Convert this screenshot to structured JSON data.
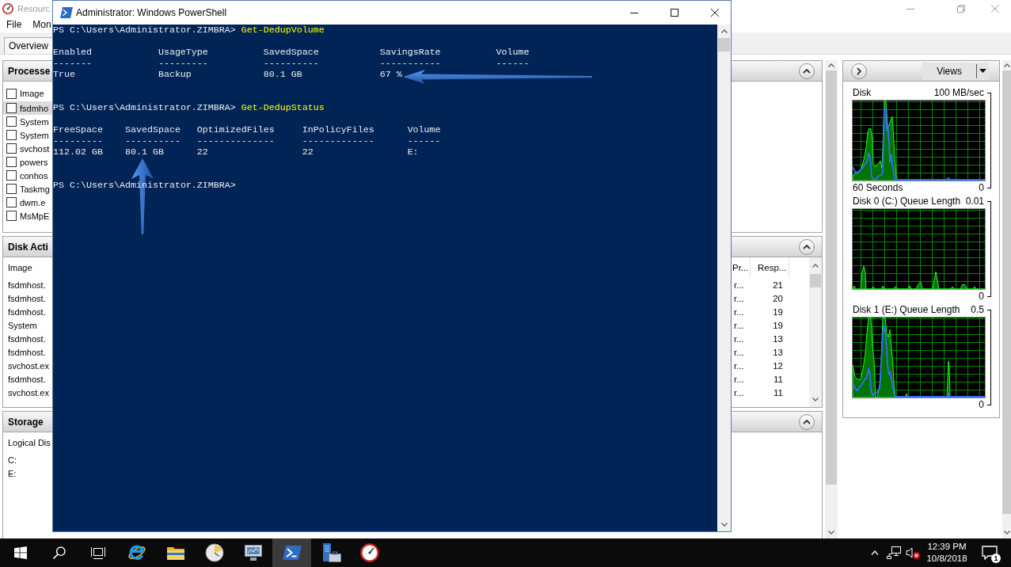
{
  "resource_monitor": {
    "title": "Resourc",
    "menu": [
      "File",
      "Mon"
    ],
    "tabs": [
      {
        "label": "Overview",
        "selected": false
      }
    ],
    "processes": {
      "title": "Processe",
      "expanded": true,
      "header": {
        "label": "Image",
        "checked": false
      },
      "rows": [
        {
          "label": "fsdmho",
          "checked": false,
          "selected": true
        },
        {
          "label": "System",
          "checked": false,
          "selected": false
        },
        {
          "label": "System",
          "checked": false,
          "selected": false
        },
        {
          "label": "svchost",
          "checked": false,
          "selected": false
        },
        {
          "label": "powers",
          "checked": false,
          "selected": false
        },
        {
          "label": "conhos",
          "checked": false,
          "selected": false
        },
        {
          "label": "Taskmg",
          "checked": false,
          "selected": false
        },
        {
          "label": "dwm.e",
          "checked": false,
          "selected": false
        },
        {
          "label": "MsMpE",
          "checked": false,
          "selected": false
        }
      ]
    },
    "disk_activity": {
      "title": "Disk Acti",
      "expanded": true,
      "columns": [
        "Image",
        "Pr...",
        "Resp..."
      ],
      "rows": [
        [
          "fsdmhost.",
          "r...",
          "21"
        ],
        [
          "fsdmhost.",
          "r...",
          "20"
        ],
        [
          "fsdmhost.",
          "r...",
          "19"
        ],
        [
          "System",
          "r...",
          "19"
        ],
        [
          "fsdmhost.",
          "r...",
          "13"
        ],
        [
          "fsdmhost.",
          "r...",
          "13"
        ],
        [
          "svchost.ex",
          "r...",
          "12"
        ],
        [
          "fsdmhost.",
          "r...",
          "11"
        ],
        [
          "svchost.ex",
          "r...",
          "11"
        ]
      ]
    },
    "storage": {
      "title": "Storage",
      "expanded": true,
      "columns": [
        "Logical Dis"
      ],
      "rows": [
        [
          "C:"
        ],
        [
          "E:"
        ]
      ]
    },
    "graph_pane": {
      "views_button": "Views",
      "graphs": [
        {
          "label": "Disk",
          "scale_max": "100 MB/sec",
          "time_span": "60 Seconds",
          "scale_min": "0"
        },
        {
          "label": "Disk 0 (C:) Queue Length",
          "scale_max": "0.01",
          "scale_min": "0"
        },
        {
          "label": "Disk 1 (E:) Queue Length",
          "scale_max": "0.5",
          "scale_min": "0"
        }
      ]
    }
  },
  "powershell": {
    "title": "Administrator: Windows PowerShell",
    "console": [
      {
        "prompt": "PS C:\\Users\\Administrator.ZIMBRA>",
        "command": "Get-DedupVolume",
        "output": [
          {
            "header": "Enabled",
            "rule": "-------",
            "value": "True"
          },
          {
            "header": "UsageType",
            "rule": "---------",
            "value": "Backup"
          },
          {
            "header": "SavedSpace",
            "rule": "----------",
            "value": "80.1 GB"
          },
          {
            "header": "SavingsRate",
            "rule": "-----------",
            "value": "67 %"
          },
          {
            "header": "Volume",
            "rule": "------"
          }
        ]
      },
      {
        "prompt": "PS C:\\Users\\Administrator.ZIMBRA>",
        "command": "Get-DedupStatus",
        "output": [
          {
            "header": "FreeSpace",
            "rule": "---------",
            "value": "112.02 GB"
          },
          {
            "header": "SavedSpace",
            "rule": "----------",
            "value": "80.1 GB"
          },
          {
            "header": "OptimizedFiles",
            "rule": "--------------",
            "value": "22"
          },
          {
            "header": "InPolicyFiles",
            "rule": "-------------",
            "value": "22"
          },
          {
            "header": "Volume",
            "rule": "------",
            "value": "E:"
          }
        ]
      },
      {
        "prompt": "PS C:\\Users\\Administrator.ZIMBRA>"
      }
    ]
  },
  "taskbar": {
    "items": [
      {
        "kind": "start",
        "active": false
      },
      {
        "kind": "search",
        "active": false
      },
      {
        "kind": "task_view",
        "active": false
      },
      {
        "kind": "browser",
        "active": false
      },
      {
        "kind": "folder",
        "active": false
      },
      {
        "kind": "performance",
        "active": false
      },
      {
        "kind": "monitor",
        "active": false
      },
      {
        "kind": "powershell",
        "active": true
      },
      {
        "kind": "server",
        "active": false
      },
      {
        "kind": "gauge",
        "active": false
      }
    ],
    "tray": {
      "volume_muted": true,
      "time": "12:39 PM",
      "date": "10/8/2018",
      "notifications": "1"
    }
  }
}
